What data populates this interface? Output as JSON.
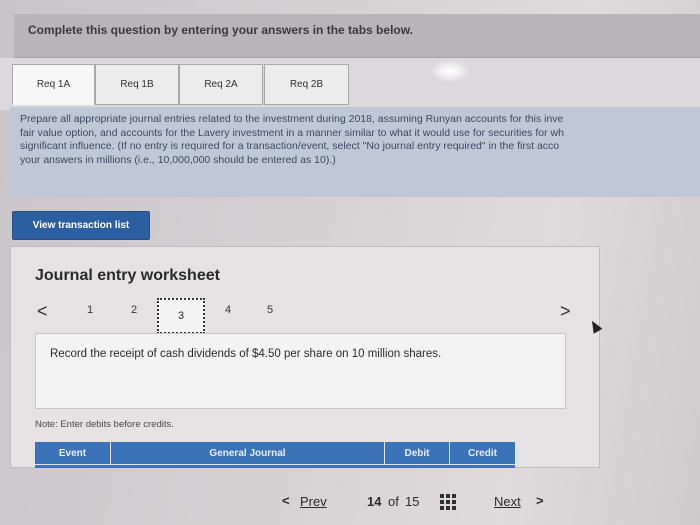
{
  "header": {
    "instruction": "Complete this question by entering your answers in the tabs below."
  },
  "tabs": [
    {
      "label": "Req 1A"
    },
    {
      "label": "Req 1B"
    },
    {
      "label": "Req 2A"
    },
    {
      "label": "Req 2B"
    }
  ],
  "instructions": {
    "line1": "Prepare all appropriate journal entries related to the investment during 2018, assuming Runyan accounts for this inve",
    "line2": "fair value option, and accounts for the Lavery investment in a manner similar to what it would use for securities for wh",
    "line3": "significant influence. (If no entry is required for a transaction/event, select \"No journal entry required\" in the first acco",
    "line4": "your answers in millions (i.e., 10,000,000 should be entered as 10).)"
  },
  "view_transaction_button": "View transaction list",
  "worksheet": {
    "title": "Journal entry worksheet",
    "prev_arrow": "<",
    "next_arrow": ">",
    "pages": [
      "1",
      "2",
      "3",
      "4",
      "5"
    ],
    "description": "Record the receipt of cash dividends of $4.50 per share on 10 million shares.",
    "note": "Note: Enter debits before credits.",
    "columns": [
      "Event",
      "General Journal",
      "Debit",
      "Credit"
    ]
  },
  "bottom_nav": {
    "prev_arrow": "<",
    "prev_label": "Prev",
    "page_current": "14",
    "page_of": "of",
    "page_total": "15",
    "next_label": "Next",
    "next_arrow": ">"
  }
}
